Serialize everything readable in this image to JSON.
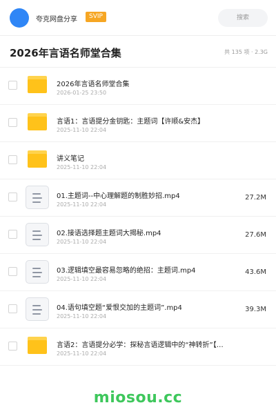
{
  "header": {
    "brand": "夸克网盘分享",
    "vip_badge": "SVIP",
    "search_label": "搜索"
  },
  "folder": {
    "title": "2026年言语名师堂合集",
    "summary": "共 135 项 · 2.3G"
  },
  "items": [
    {
      "type": "folder",
      "name": "2026年言语名师堂合集",
      "date": "2026-01-25 23:50",
      "size": ""
    },
    {
      "type": "folder",
      "name": "言语1：言语提分金钥匙：主题词【许顺&安杰】",
      "date": "2025-11-10 22:04",
      "size": ""
    },
    {
      "type": "folder",
      "name": "讲义笔记",
      "date": "2025-11-10 22:04",
      "size": ""
    },
    {
      "type": "file",
      "name": "01.主题词--中心理解题的制胜妙招.mp4",
      "date": "2025-11-10 22:04",
      "size": "27.2M"
    },
    {
      "type": "file",
      "name": "02.接语选择题主题词大揭秘.mp4",
      "date": "2025-11-10 22:04",
      "size": "27.6M"
    },
    {
      "type": "file",
      "name": "03.逻辑填空最容易忽略的绝招：主题词.mp4",
      "date": "2025-11-10 22:04",
      "size": "43.6M"
    },
    {
      "type": "file",
      "name": "04.语句填空题“爱恨交加的主题词”.mp4",
      "date": "2025-11-10 22:04",
      "size": "39.3M"
    },
    {
      "type": "folder",
      "name": "言语2：言语提分必学：探秘言语逻辑中的“神转折”【…",
      "date": "2025-11-10 22:04",
      "size": ""
    }
  ],
  "watermark": "miosou.cc",
  "colors": {
    "accent": "#2f86f6",
    "vip": "#f6a623",
    "folder": "#ffc21a",
    "watermark": "#3ec75c"
  }
}
